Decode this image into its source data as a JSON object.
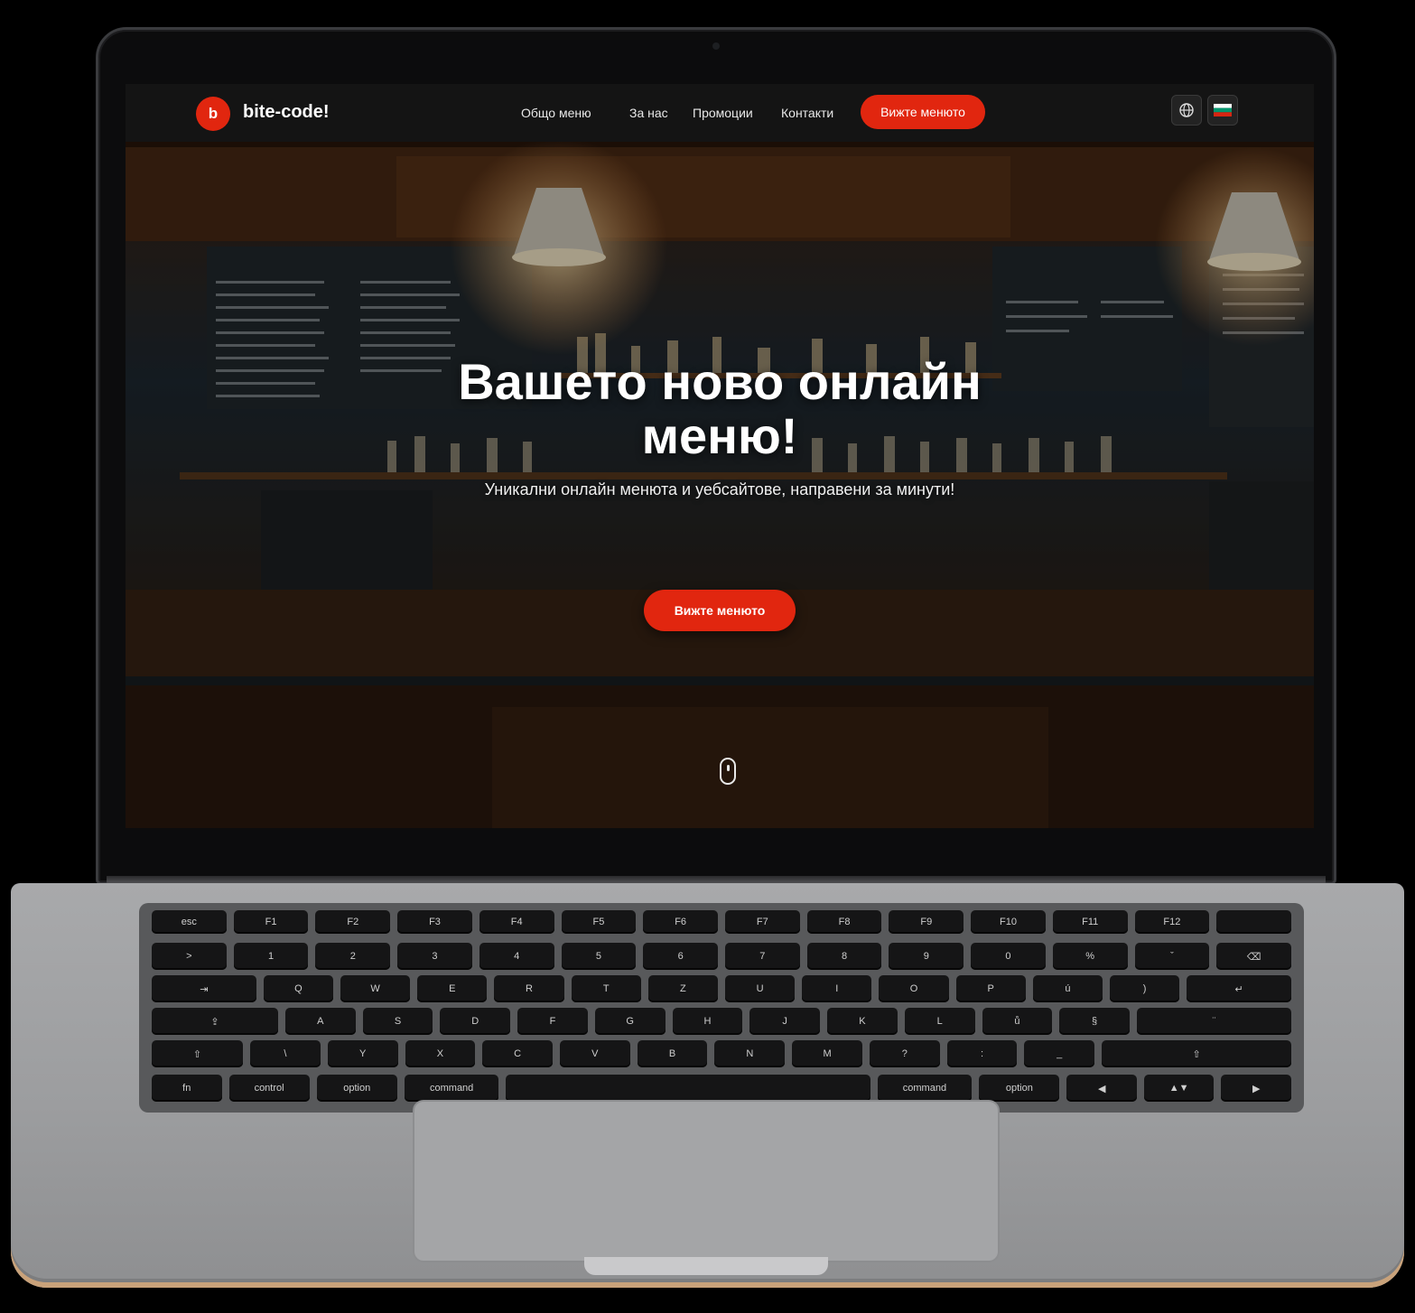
{
  "brand": {
    "logo_letter": "b",
    "name": "bite-code!"
  },
  "nav": {
    "links": [
      "Общо меню",
      "За нас",
      "Промоции",
      "Контакти"
    ],
    "cta_label": "Вижте менюто",
    "icons": [
      "globe-icon",
      "language-flag-icon"
    ]
  },
  "hero": {
    "title_line1": "Вашето ново онлайн",
    "title_line2": "меню!",
    "subtitle": "Уникални онлайн менюта и уебсайтове, направени за минути!",
    "cta_label": "Вижте менюто"
  },
  "colors": {
    "accent": "#e1260f",
    "nav_bg": "#141414",
    "laptop_body": "#9c9d9f"
  },
  "keyboard": {
    "rows": [
      [
        "esc",
        "F1",
        "F2",
        "F3",
        "F4",
        "F5",
        "F6",
        "F7",
        "F8",
        "F9",
        "F10",
        "F11",
        "F12",
        ""
      ],
      [
        ">",
        "1",
        "2",
        "3",
        "4",
        "5",
        "6",
        "7",
        "8",
        "9",
        "0",
        "%",
        "ˇ",
        "⌫"
      ],
      [
        "⇥",
        "Q",
        "W",
        "E",
        "R",
        "T",
        "Z",
        "U",
        "I",
        "O",
        "P",
        "ú",
        ")",
        "↵"
      ],
      [
        "⇪",
        "A",
        "S",
        "D",
        "F",
        "G",
        "H",
        "J",
        "K",
        "L",
        "ů",
        "§",
        "¨"
      ],
      [
        "⇧",
        "\\",
        "Y",
        "X",
        "C",
        "V",
        "B",
        "N",
        "M",
        "?",
        ":",
        "_",
        "⇧"
      ],
      [
        "fn",
        "control",
        "option",
        "command",
        "",
        "command",
        "option",
        "◀",
        "▲▼",
        "▶"
      ]
    ]
  }
}
